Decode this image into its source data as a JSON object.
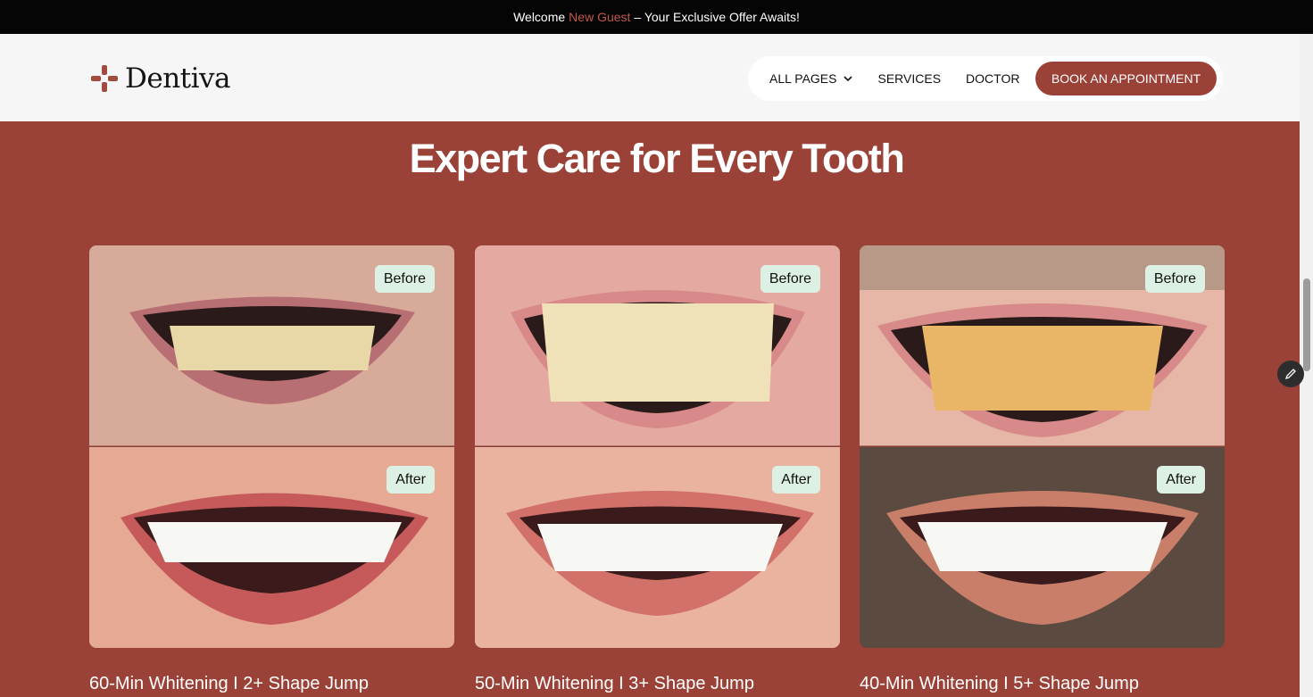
{
  "topbar": {
    "welcome": "Welcome",
    "guest": "New Guest",
    "offer": "– Your Exclusive Offer Awaits!"
  },
  "brand": {
    "name": "Dentiva",
    "logo_icon": "plus-cross-icon"
  },
  "nav": {
    "all_pages": "ALL PAGES",
    "services": "SERVICES",
    "doctor": "DOCTOR",
    "cta": "BOOK AN APPOINTMENT"
  },
  "section": {
    "title": "Expert Care for Every Tooth"
  },
  "cards": [
    {
      "before_label": "Before",
      "after_label": "After",
      "caption": "60-Min Whitening I 2+ Shape Jump"
    },
    {
      "before_label": "Before",
      "after_label": "After",
      "caption": "50-Min Whitening I 3+ Shape Jump"
    },
    {
      "before_label": "Before",
      "after_label": "After",
      "caption": "40-Min Whitening I 5+ Shape Jump"
    }
  ],
  "colors": {
    "brand": "#9a4237",
    "accent_text": "#c0584a",
    "badge_bg": "#dcf0e3",
    "topbar_bg": "#050505"
  }
}
